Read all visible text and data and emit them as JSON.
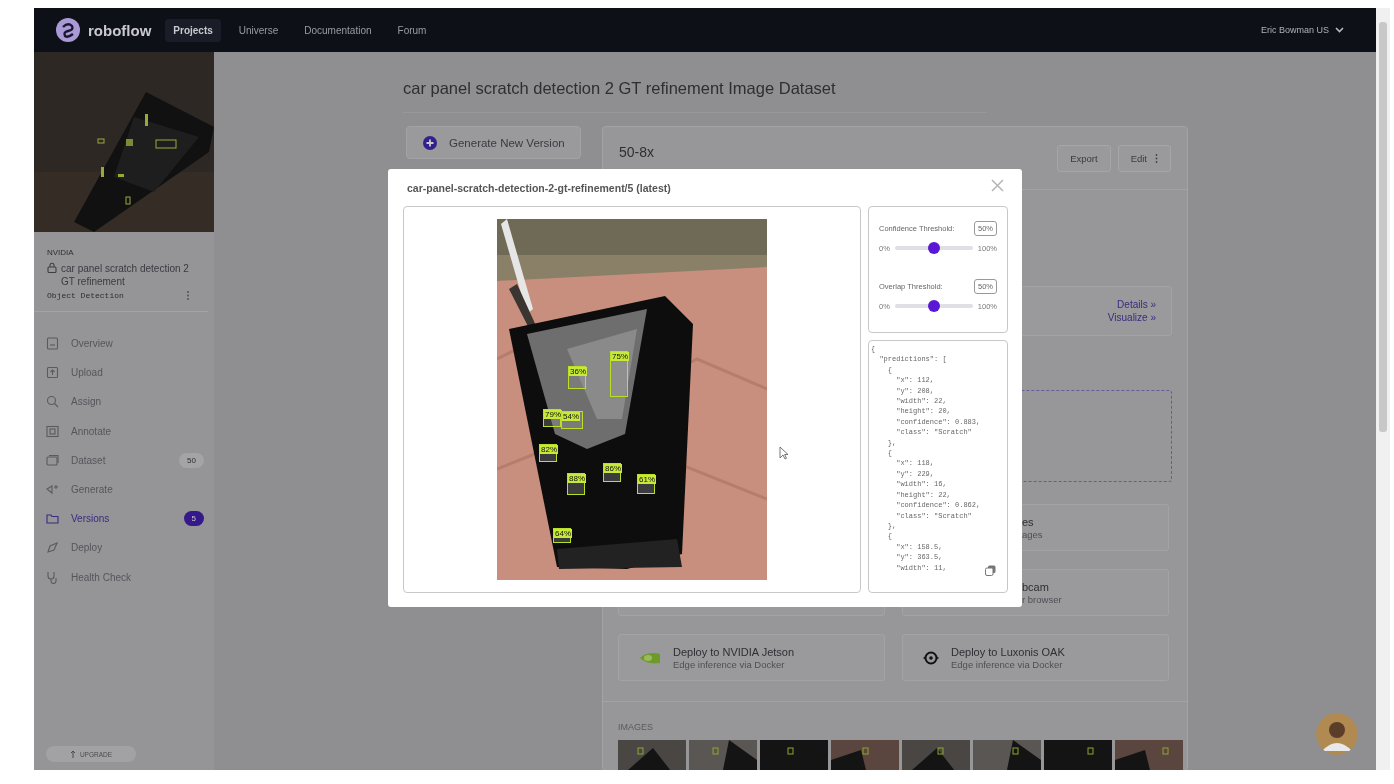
{
  "nav": {
    "brand": "roboflow",
    "tabs": [
      {
        "label": "Projects",
        "selected": true
      },
      {
        "label": "Universe",
        "selected": false
      },
      {
        "label": "Documentation",
        "selected": false
      },
      {
        "label": "Forum",
        "selected": false
      }
    ],
    "user": "Eric Bowman US"
  },
  "sidebar": {
    "workspace": "NVIDIA",
    "project": "car panel scratch detection 2 GT refinement",
    "project_type": "Object Detection",
    "items": [
      {
        "label": "Overview",
        "selected": false
      },
      {
        "label": "Upload",
        "selected": false
      },
      {
        "label": "Assign",
        "selected": false
      },
      {
        "label": "Annotate",
        "selected": false
      },
      {
        "label": "Dataset",
        "selected": false,
        "badge": "50"
      },
      {
        "label": "Generate",
        "selected": false
      },
      {
        "label": "Versions",
        "selected": true,
        "badge": "5"
      },
      {
        "label": "Deploy",
        "selected": false
      },
      {
        "label": "Health Check",
        "selected": false
      }
    ],
    "upgrade": "UPGRADE"
  },
  "page": {
    "title": "car panel scratch detection 2 GT refinement Image Dataset",
    "generate_button": "Generate New Version",
    "version": {
      "name": "50-8x",
      "buttons": [
        "Export",
        "Edit"
      ],
      "links": [
        "Details »",
        "Visualize »"
      ],
      "cards": [
        {
          "title": "es",
          "subtitle": "ages"
        },
        {
          "title": "bcam",
          "subtitle": "r browser"
        },
        {
          "title": "Deploy to NVIDIA Jetson",
          "subtitle": "Edge inference via Docker",
          "kind": "nvidia"
        },
        {
          "title": "Deploy to Luxonis OAK",
          "subtitle": "Edge inference via Docker",
          "kind": "oak"
        }
      ],
      "images_label": "IMAGES"
    }
  },
  "modal": {
    "title": "car-panel-scratch-detection-2-gt-refinement/5 (latest)",
    "detections": [
      {
        "label": "75%"
      },
      {
        "label": "36%"
      },
      {
        "label": "79%"
      },
      {
        "label": "54%"
      },
      {
        "label": "82%"
      },
      {
        "label": "88%"
      },
      {
        "label": "86%"
      },
      {
        "label": "61%"
      },
      {
        "label": "64%"
      }
    ],
    "sliders": [
      {
        "label": "Confidence Threshold:",
        "value": "50%",
        "min": "0%",
        "max": "100%",
        "level": 0.5
      },
      {
        "label": "Overlap Threshold:",
        "value": "50%",
        "min": "0%",
        "max": "100%",
        "level": 0.5
      }
    ],
    "code_lines": [
      "{",
      "  \"predictions\": [",
      "    {",
      "      \"x\": 112,",
      "      \"y\": 208,",
      "      \"width\": 22,",
      "      \"height\": 20,",
      "      \"confidence\": 0.883,",
      "      \"class\": \"Scratch\"",
      "    },",
      "    {",
      "      \"x\": 118,",
      "      \"y\": 229,",
      "      \"width\": 16,",
      "      \"height\": 22,",
      "      \"confidence\": 0.862,",
      "      \"class\": \"Scratch\"",
      "    },",
      "    {",
      "      \"x\": 158.5,",
      "      \"y\": 363.5,",
      "      \"width\": 11,"
    ]
  }
}
